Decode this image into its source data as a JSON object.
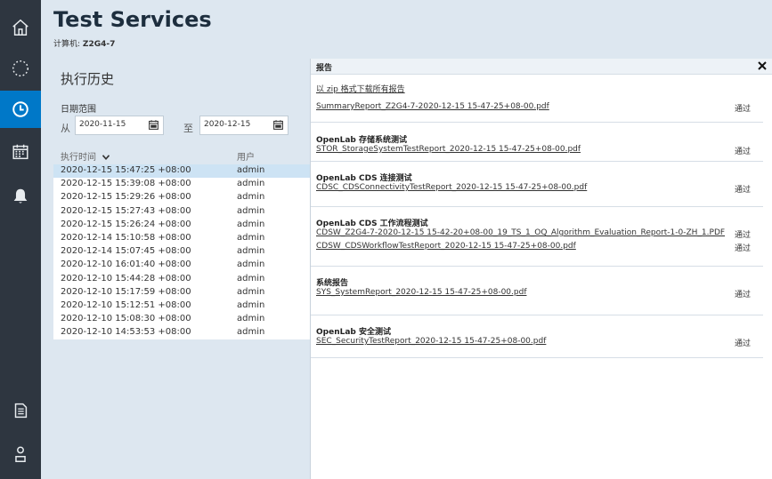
{
  "sidebar": {
    "items": [
      {
        "name": "home-icon"
      },
      {
        "name": "loading-icon"
      },
      {
        "name": "history-clock-icon",
        "active": true
      },
      {
        "name": "calendar-icon"
      },
      {
        "name": "bell-icon"
      },
      {
        "name": "document-icon"
      },
      {
        "name": "user-icon"
      }
    ],
    "active_color": "#0078c8",
    "bg_color": "#2e3640"
  },
  "header": {
    "title": "Test Services",
    "computer_label": "计算机:",
    "computer_name": "Z2G4-7"
  },
  "history": {
    "title": "执行历史",
    "date_range_label": "日期范围",
    "from_label": "从",
    "to_label": "至",
    "from_date": "2020-11-15",
    "to_date": "2020-12-15",
    "col_time": "执行时间",
    "col_user": "用户",
    "rows": [
      {
        "time": "2020-12-15 15:47:25 +08:00",
        "user": "admin"
      },
      {
        "time": "2020-12-15 15:39:08 +08:00",
        "user": "admin"
      },
      {
        "time": "2020-12-15 15:29:26 +08:00",
        "user": "admin"
      },
      {
        "time": "2020-12-15 15:27:43 +08:00",
        "user": "admin"
      },
      {
        "time": "2020-12-15 15:26:24 +08:00",
        "user": "admin"
      },
      {
        "time": "2020-12-14 15:10:58 +08:00",
        "user": "admin"
      },
      {
        "time": "2020-12-14 15:07:45 +08:00",
        "user": "admin"
      },
      {
        "time": "2020-12-10 16:01:40 +08:00",
        "user": "admin"
      },
      {
        "time": "2020-12-10 15:44:28 +08:00",
        "user": "admin"
      },
      {
        "time": "2020-12-10 15:17:59 +08:00",
        "user": "admin"
      },
      {
        "time": "2020-12-10 15:12:51 +08:00",
        "user": "admin"
      },
      {
        "time": "2020-12-10 15:08:30 +08:00",
        "user": "admin"
      },
      {
        "time": "2020-12-10 14:53:53 +08:00",
        "user": "admin"
      }
    ]
  },
  "report": {
    "title": "报告",
    "zip_link": "以 zip 格式下载所有报告",
    "summary": {
      "file": "SummaryReport_Z2G4-7-2020-12-15 15-47-25+08-00.pdf",
      "status": "通过"
    },
    "sections": [
      {
        "title": "OpenLab 存储系统测试",
        "files": [
          {
            "file": "STOR_StorageSystemTestReport_2020-12-15 15-47-25+08-00.pdf",
            "status": "通过"
          }
        ]
      },
      {
        "title": "OpenLab CDS 连接测试",
        "files": [
          {
            "file": "CDSC_CDSConnectivityTestReport_2020-12-15 15-47-25+08-00.pdf",
            "status": "通过"
          }
        ]
      },
      {
        "title": "OpenLab CDS 工作流程测试",
        "files": [
          {
            "file": "CDSW_Z2G4-7-2020-12-15 15-42-20+08-00_19_TS_1_OQ_Algorithm_Evaluation_Report-1-0-ZH_1.PDF",
            "status": "通过"
          },
          {
            "file": "CDSW_CDSWorkflowTestReport_2020-12-15 15-47-25+08-00.pdf",
            "status": "通过"
          }
        ]
      },
      {
        "title": "系统报告",
        "files": [
          {
            "file": "SYS_SystemReport_2020-12-15 15-47-25+08-00.pdf",
            "status": "通过"
          }
        ]
      },
      {
        "title": "OpenLab 安全测试",
        "files": [
          {
            "file": "SEC_SecurityTestReport_2020-12-15 15-47-25+08-00.pdf",
            "status": "通过"
          }
        ]
      }
    ]
  }
}
